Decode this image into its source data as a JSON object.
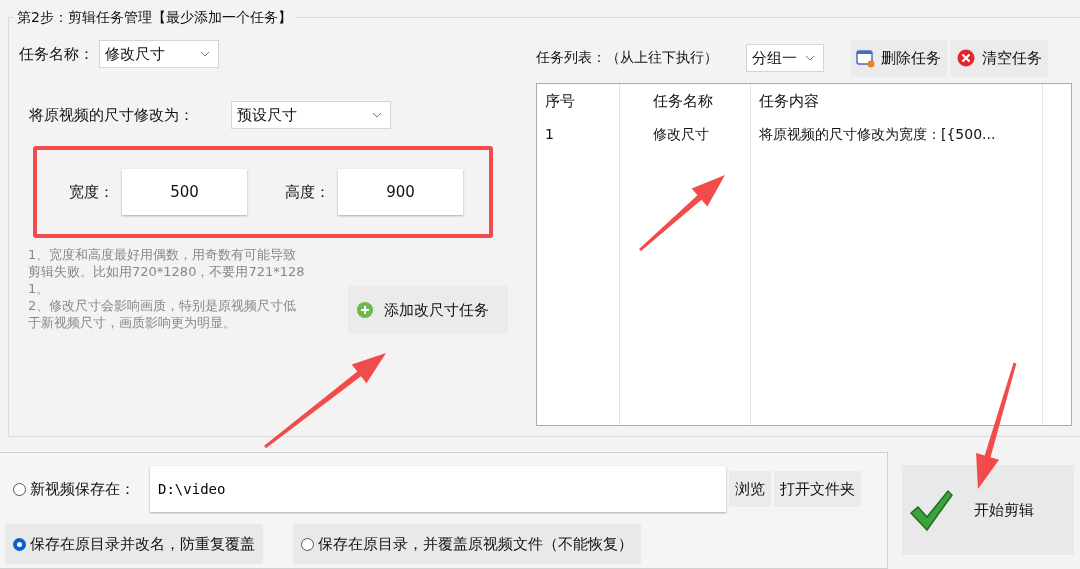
{
  "group_title": "第2步：剪辑任务管理【最少添加一个任务】",
  "task_name": {
    "label": "任务名称：",
    "value": "修改尺寸"
  },
  "resize_mode": {
    "label": "将原视频的尺寸修改为：",
    "value": "预设尺寸"
  },
  "size_fields": [
    {
      "label": "宽度：",
      "value": "500"
    },
    {
      "label": "高度：",
      "value": "900"
    }
  ],
  "notes": [
    "1、宽度和高度最好用偶数，用奇数有可能导致剪辑失败。比如用720*1280，不要用721*1281。",
    "2、修改尺寸会影响画质，特别是原视频尺寸低于新视频尺寸，画质影响更为明显。"
  ],
  "add_button": "添加改尺寸任务",
  "task_list": {
    "label": "任务列表：（从上往下执行）",
    "group": "分组一",
    "buttons": [
      {
        "kind": "delete",
        "label": "删除任务"
      },
      {
        "kind": "clear",
        "label": "清空任务"
      }
    ],
    "columns": [
      "序号",
      "任务名称",
      "任务内容"
    ],
    "rows": [
      [
        "1",
        "修改尺寸",
        "将原视频的尺寸修改为宽度：[{500..."
      ]
    ]
  },
  "save_to_folder": {
    "label": "新视频保存在：",
    "selected": false,
    "path": "D:\\video"
  },
  "browse_button": "浏览",
  "open_folder_button": "打开文件夹",
  "save_options": [
    {
      "label": "保存在原目录并改名，防重复覆盖",
      "selected": true
    },
    {
      "label": "保存在原目录，并覆盖原视频文件（不能恢复）",
      "selected": false
    }
  ],
  "start_button": "开始剪辑"
}
